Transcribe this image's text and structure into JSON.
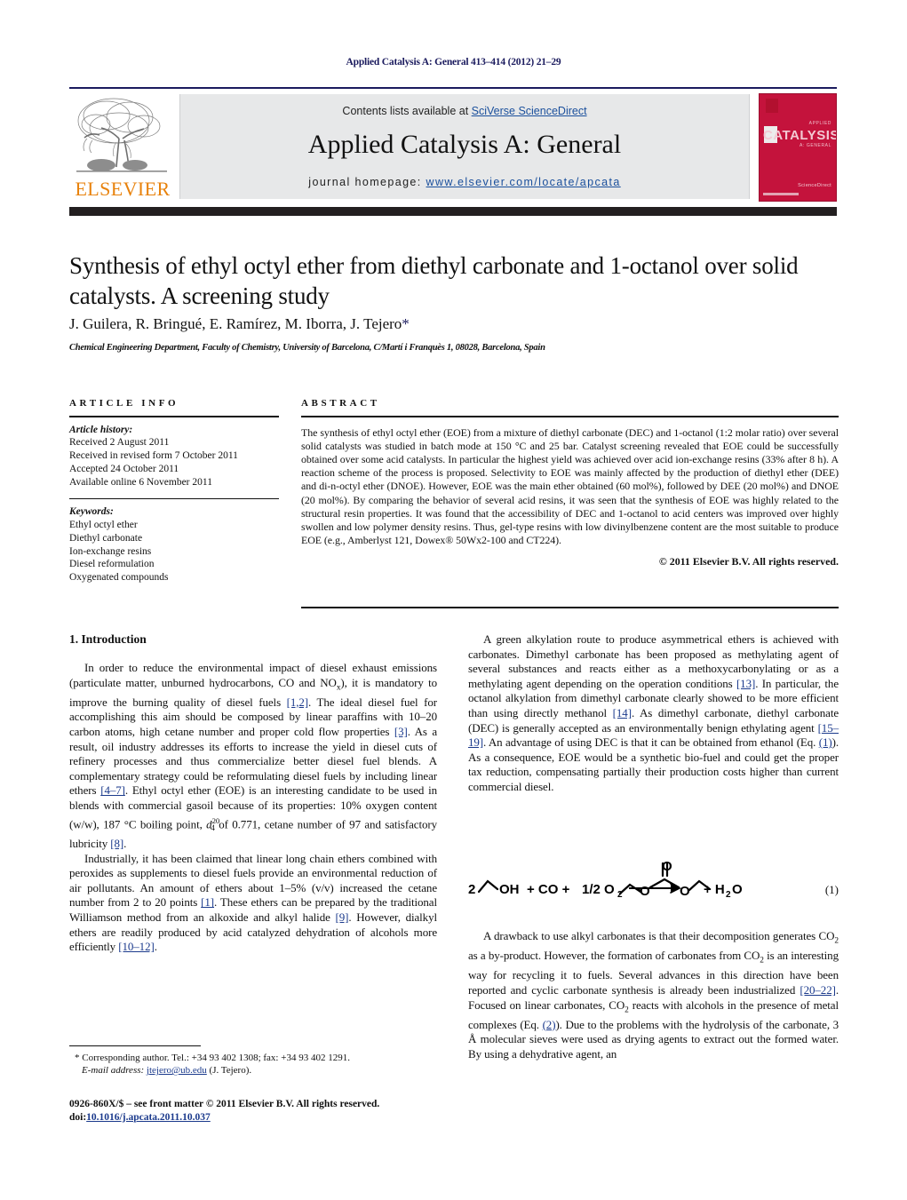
{
  "running_head": "Applied Catalysis A: General 413–414 (2012) 21–29",
  "masthead": {
    "contents_prefix": "Contents lists available at ",
    "contents_link": "SciVerse ScienceDirect",
    "journal_title": "Applied Catalysis A: General",
    "homepage_prefix": "journal homepage: ",
    "homepage_url": "www.elsevier.com/locate/apcata",
    "publisher_wordmark": "ELSEVIER",
    "cover": {
      "main_word": "CATALYSIS",
      "kicker": "APPLIED",
      "sub": "A: GENERAL",
      "sciencedirect": "ScienceDirect"
    }
  },
  "article": {
    "title": "Synthesis of ethyl octyl ether from diethyl carbonate and 1-octanol over solid catalysts. A screening study",
    "authors": "J. Guilera, R. Bringué, E. Ramírez, M. Iborra, J. Tejero",
    "corresponding_marker": "*",
    "affiliation": "Chemical Engineering Department, Faculty of Chemistry, University of Barcelona, C/Martí i Franquès 1, 08028, Barcelona, Spain"
  },
  "article_info": {
    "heading": "ARTICLE INFO",
    "history_label": "Article history:",
    "history": [
      "Received 2 August 2011",
      "Received in revised form 7 October 2011",
      "Accepted 24 October 2011",
      "Available online 6 November 2011"
    ],
    "keywords_label": "Keywords:",
    "keywords": [
      "Ethyl octyl ether",
      "Diethyl carbonate",
      "Ion-exchange resins",
      "Diesel reformulation",
      "Oxygenated compounds"
    ]
  },
  "abstract": {
    "heading": "ABSTRACT",
    "text": "The synthesis of ethyl octyl ether (EOE) from a mixture of diethyl carbonate (DEC) and 1-octanol (1:2 molar ratio) over several solid catalysts was studied in batch mode at 150 °C and 25 bar. Catalyst screening revealed that EOE could be successfully obtained over some acid catalysts. In particular the highest yield was achieved over acid ion-exchange resins (33% after 8 h). A reaction scheme of the process is proposed. Selectivity to EOE was mainly affected by the production of diethyl ether (DEE) and di-n-octyl ether (DNOE). However, EOE was the main ether obtained (60 mol%), followed by DEE (20 mol%) and DNOE (20 mol%). By comparing the behavior of several acid resins, it was seen that the synthesis of EOE was highly related to the structural resin properties. It was found that the accessibility of DEC and 1-octanol to acid centers was improved over highly swollen and low polymer density resins. Thus, gel-type resins with low divinylbenzene content are the most suitable to produce EOE (e.g., Amberlyst 121, Dowex® 50Wx2-100 and CT224).",
    "copyright": "© 2011 Elsevier B.V. All rights reserved."
  },
  "section": {
    "number_and_title": "1. Introduction"
  },
  "left_column": {
    "p1": {
      "a": "In order to reduce the environmental impact of diesel exhaust emissions (particulate matter, unburned hydrocarbons, CO and NO",
      "b": "x",
      "c": "), it is mandatory to improve the burning quality of diesel fuels ",
      "ref1": "[1,2]",
      "d": ". The ideal diesel fuel for accomplishing this aim should be composed by linear paraffins with 10–20 carbon atoms, high cetane number and proper cold flow properties ",
      "ref2": "[3]",
      "e": ". As a result, oil industry addresses its efforts to increase the yield in diesel cuts of refinery processes and thus commercialize better diesel fuel blends. A complementary strategy could be reformulating diesel fuels by including linear ethers ",
      "ref3": "[4–7]",
      "f": ". Ethyl octyl ether (EOE) is an interesting candidate to be used in blends with commercial gasoil because of its properties: 10% oxygen content (w/w), 187 °C boiling point, ",
      "g_sym": "d",
      "g_sup": "20",
      "g_sub": "4",
      "h": " of 0.771, cetane number of 97 and satisfactory lubricity ",
      "ref4": "[8]",
      "i": "."
    },
    "p2": {
      "a": "Industrially, it has been claimed that linear long chain ethers combined with peroxides as supplements to diesel fuels provide an environmental reduction of air pollutants. An amount of ethers about 1–5% (v/v) increased the cetane number from 2 to 20 points ",
      "ref1": "[1]",
      "b": ". These ethers can be prepared by the traditional Williamson method from an alkoxide and alkyl halide ",
      "ref2": "[9]",
      "c": ". However, dialkyl ethers are readily produced by acid catalyzed dehydration of alcohols more efficiently ",
      "ref3": "[10–12]",
      "d": "."
    }
  },
  "right_column": {
    "p1": {
      "a": "A green alkylation route to produce asymmetrical ethers is achieved with carbonates. Dimethyl carbonate has been proposed as methylating agent of several substances and reacts either as a methoxycarbonylating or as a methylating agent depending on the operation conditions ",
      "ref1": "[13]",
      "b": ". In particular, the octanol alkylation from dimethyl carbonate clearly showed to be more efficient than using directly methanol ",
      "ref2": "[14]",
      "c": ". As dimethyl carbonate, diethyl carbonate (DEC) is generally accepted as an environmentally benign ethylating agent ",
      "ref3": "[15–19]",
      "d": ". An advantage of using DEC is that it can be obtained from ethanol (Eq. ",
      "eqref": "(1)",
      "e": "). As a consequence, EOE would be a synthetic bio-fuel and could get the proper tax reduction, compensating partially their production costs higher than current commercial diesel."
    },
    "p2": {
      "a": "A drawback to use alkyl carbonates is that their decomposition generates CO",
      "sub1": "2",
      "b": " as a by-product. However, the formation of carbonates from CO",
      "sub2": "2",
      "c": " is an interesting way for recycling it to fuels. Several advances in this direction have been reported and cyclic carbonate synthesis is already been industrialized ",
      "ref1": "[20–22]",
      "d": ". Focused on linear carbonates, CO",
      "sub3": "2",
      "e": " reacts with alcohols in the presence of metal complexes (Eq. ",
      "eqref": "(2)",
      "f": "). Due to the problems with the hydrolysis of the carbonate, 3 Å molecular sieves were used as drying agents to extract out the formed water. By using a dehydrative agent, an"
    }
  },
  "equation_1": {
    "number": "(1)",
    "left_coefficient": "2",
    "left_group": "OH",
    "plus_co": "+ CO +",
    "half_o2_prefix": "1/2 O",
    "half_o2_sub": "2",
    "right_plus": "+ H",
    "right_sub": "2",
    "right_tail": "O",
    "carbonyl_o": "O",
    "ester_o_left": "O",
    "ester_o_right": "O"
  },
  "footnote": {
    "star": "*",
    "line1": " Corresponding author. Tel.: +34 93 402 1308; fax: +34 93 402 1291.",
    "email_label": "E-mail address:",
    "email": "jtejero@ub.edu",
    "email_tail": " (J. Tejero)."
  },
  "imprint": {
    "line1": "0926-860X/$ – see front matter © 2011 Elsevier B.V. All rights reserved.",
    "doi_label": "doi:",
    "doi": "10.1016/j.apcata.2011.10.037"
  },
  "colors": {
    "link": "#1b3a8c",
    "elsevier_orange": "#e8820c",
    "cover_red": "#c4133c",
    "navy": "#1b1b5e",
    "band_gray": "#e7e8e9"
  }
}
